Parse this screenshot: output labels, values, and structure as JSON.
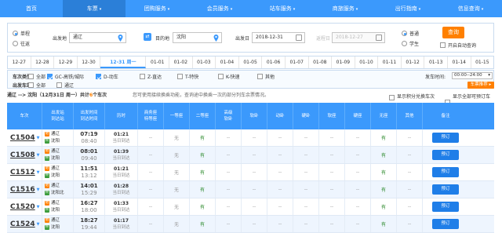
{
  "nav": [
    "首页",
    "车票",
    "团购服务",
    "会员服务",
    "站车服务",
    "商旅服务",
    "出行指南",
    "信息查询"
  ],
  "search": {
    "trip_types": [
      "单程",
      "往返"
    ],
    "from_label": "出发地",
    "from_value": "通辽",
    "to_label": "目的地",
    "to_value": "沈阳",
    "depart_label": "出发日",
    "depart_value": "2018-12-31",
    "return_label": "返程日",
    "return_value": "2018-12-27",
    "passenger_types": [
      "普通",
      "学生"
    ],
    "query_label": "查询",
    "auto_query_label": "开启自动查询"
  },
  "dates": [
    "12-27",
    "12-28",
    "12-29",
    "12-30",
    "12-31 周一",
    "01-01",
    "01-02",
    "01-03",
    "01-04",
    "01-05",
    "01-06",
    "01-07",
    "01-08",
    "01-09",
    "01-10",
    "01-11",
    "01-12",
    "01-13",
    "01-14",
    "01-15"
  ],
  "filters": {
    "type_label": "车次类型:",
    "types": [
      {
        "label": "全部",
        "checked": false
      },
      {
        "label": "GC-高铁/城际",
        "checked": true
      },
      {
        "label": "D-动车",
        "checked": true
      },
      {
        "label": "Z-直达",
        "checked": false
      },
      {
        "label": "T-特快",
        "checked": false
      },
      {
        "label": "K-快速",
        "checked": false
      },
      {
        "label": "其他",
        "checked": false
      }
    ],
    "station_label": "出发车站:",
    "stations": [
      {
        "label": "全部",
        "checked": false
      },
      {
        "label": "通辽",
        "checked": false
      }
    ],
    "time_label": "发车时间:",
    "time_value": "00:00--24:00",
    "sort_button": "车票推荐 ▸"
  },
  "info": {
    "route": "通辽 --> 沈阳（12月31日 周一）共计",
    "count": "6",
    "count_suffix": "个车次",
    "tip": "您可使用接续换乘功能，查询途中换乘一次的部分列车余票情况。",
    "opt1": "显示积分兑换车次",
    "opt2": "显示全部可预订车次"
  },
  "table": {
    "headers": [
      "车次",
      "出发站\n到达站",
      "出发时间\n到达时间",
      "历时",
      "商务座\n特等座",
      "一等座",
      "二等座",
      "高级\n软卧",
      "软卧",
      "动卧",
      "硬卧",
      "软座",
      "硬座",
      "无座",
      "其他",
      "备注"
    ],
    "rows": [
      {
        "train": "C1504",
        "from": "通辽",
        "to": "沈阳",
        "dep": "07:19",
        "arr": "08:40",
        "dur": "01:21",
        "day": "当日到达",
        "seats": [
          "--",
          "无",
          "有",
          "--",
          "--",
          "--",
          "--",
          "--",
          "--",
          "有",
          "--"
        ],
        "book": "预订"
      },
      {
        "train": "C1508",
        "from": "通辽",
        "to": "沈阳",
        "dep": "08:01",
        "arr": "09:40",
        "dur": "01:39",
        "day": "当日到达",
        "seats": [
          "--",
          "无",
          "有",
          "--",
          "--",
          "--",
          "--",
          "--",
          "--",
          "有",
          "--"
        ],
        "book": "预订"
      },
      {
        "train": "C1512",
        "from": "通辽",
        "to": "沈阳",
        "dep": "11:51",
        "arr": "13:12",
        "dur": "01:21",
        "day": "当日到达",
        "seats": [
          "--",
          "无",
          "有",
          "--",
          "--",
          "--",
          "--",
          "--",
          "--",
          "有",
          "--"
        ],
        "book": "预订"
      },
      {
        "train": "C1516",
        "from": "通辽",
        "to": "沈阳北",
        "dep": "14:01",
        "arr": "15:29",
        "dur": "01:28",
        "day": "当日到达",
        "seats": [
          "--",
          "无",
          "有",
          "--",
          "--",
          "--",
          "--",
          "--",
          "--",
          "有",
          "--"
        ],
        "book": "预订"
      },
      {
        "train": "C1520",
        "from": "通辽",
        "to": "沈阳",
        "dep": "16:27",
        "arr": "18:00",
        "dur": "01:33",
        "day": "当日到达",
        "seats": [
          "--",
          "无",
          "有",
          "--",
          "--",
          "--",
          "--",
          "--",
          "--",
          "有",
          "--"
        ],
        "book": "预订"
      },
      {
        "train": "C1524",
        "from": "通辽",
        "to": "沈阳",
        "dep": "18:27",
        "arr": "19:44",
        "dur": "01:17",
        "day": "当日到达",
        "seats": [
          "--",
          "无",
          "有",
          "--",
          "--",
          "--",
          "--",
          "--",
          "--",
          "有",
          "--"
        ],
        "book": "预订"
      }
    ]
  },
  "colors": {
    "primary": "#3b99fc",
    "accent": "#ff8000",
    "available": "#2e8b2e"
  }
}
